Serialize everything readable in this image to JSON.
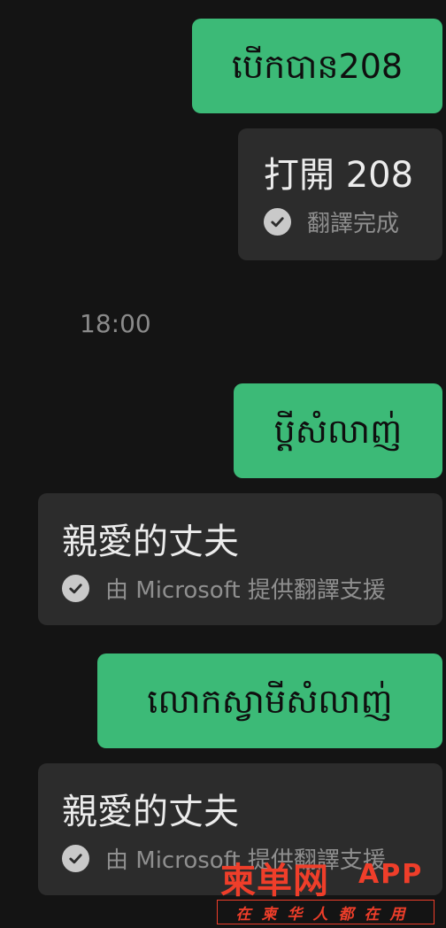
{
  "messages": [
    {
      "original": "បើកបាន208",
      "translation": "打開 208",
      "status": "翻譯完成"
    },
    {
      "original": "ប្តីសំលាញ់",
      "translation": "親愛的丈夫",
      "status": "由 Microsoft 提供翻譯支援"
    },
    {
      "original": "លោកស្វាមីសំលាញ់",
      "translation": "親愛的丈夫",
      "status": "由 Microsoft 提供翻譯支援"
    }
  ],
  "timestamp": "18:00",
  "watermark": {
    "brand": "柬单网",
    "suffix": "APP",
    "slogan": "在柬华人都在用"
  },
  "colors": {
    "background": "#141414",
    "sent_bubble": "#3cba77",
    "translation_bubble": "#2c2c2c",
    "watermark": "#ef3e2a"
  }
}
